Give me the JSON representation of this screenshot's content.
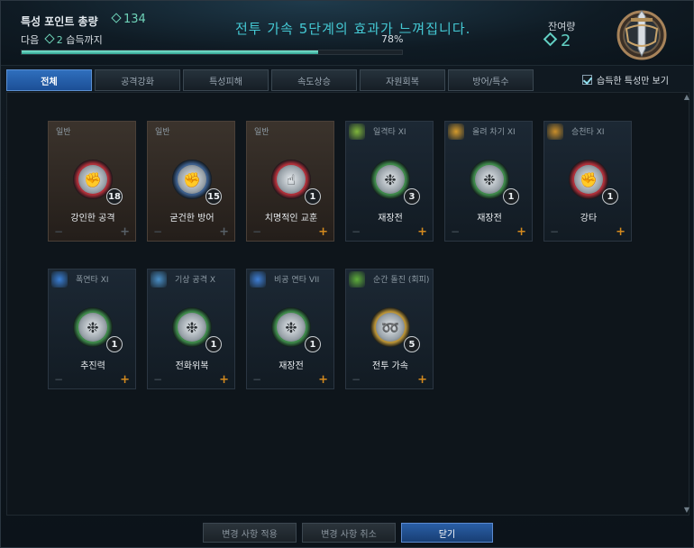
{
  "header": {
    "title": "특성 포인트 총량",
    "total_points": "134",
    "next_prefix": "다음",
    "next_points": "2",
    "next_suffix": "습득까지",
    "message": "전투 가속 5단계의 효과가 느껴집니다.",
    "progress_percent": "78%",
    "progress_value": 0.78,
    "remaining_label": "잔여량",
    "remaining_value": "2"
  },
  "tabs": [
    "전체",
    "공격강화",
    "특성피해",
    "속도상승",
    "자원회복",
    "방어/특수"
  ],
  "show_owned_label": "습득한 특성만 보기",
  "cards": [
    {
      "category": "일반",
      "name": "강인한 공격",
      "count": "18",
      "style": "basic",
      "ring": "#b0303a",
      "icon": "fist-bandage-icon",
      "plus_active": false
    },
    {
      "category": "일반",
      "name": "굳건한 방어",
      "count": "15",
      "style": "basic",
      "ring": "#3d5f8c",
      "icon": "fist-guard-icon",
      "plus_active": false
    },
    {
      "category": "일반",
      "name": "치명적인 교훈",
      "count": "1",
      "style": "basic",
      "ring": "#b0303a",
      "icon": "pointing-hand-icon",
      "plus_active": true
    },
    {
      "category": "일격타 XI",
      "name": "재장전",
      "count": "3",
      "style": "skill",
      "ring": "#3f8a4b",
      "icon": "reload-web-icon",
      "plus_active": true
    },
    {
      "category": "올려 차기 XI",
      "name": "재장전",
      "count": "1",
      "style": "skill",
      "ring": "#3f8a4b",
      "icon": "reload-web-icon",
      "plus_active": true
    },
    {
      "category": "승천타 XI",
      "name": "강타",
      "count": "1",
      "style": "skill",
      "ring": "#b0303a",
      "icon": "fist-icon",
      "plus_active": true
    },
    {
      "category": "폭연타 XI",
      "name": "추진력",
      "count": "1",
      "style": "skill",
      "ring": "#3f8a4b",
      "icon": "reload-web-icon",
      "plus_active": true
    },
    {
      "category": "기상 공격 X",
      "name": "전화위복",
      "count": "1",
      "style": "skill",
      "ring": "#3f8a4b",
      "icon": "reload-web-icon",
      "plus_active": true
    },
    {
      "category": "비공 연타 VII",
      "name": "재장전",
      "count": "1",
      "style": "skill",
      "ring": "#3f8a4b",
      "icon": "reload-web-icon",
      "plus_active": true
    },
    {
      "category": "순간 돌진 (회피)",
      "name": "전투 가속",
      "count": "5",
      "style": "skill",
      "ring": "#b99338",
      "icon": "running-foot-icon",
      "plus_active": true
    }
  ],
  "buttons": {
    "apply": "변경 사항 적용",
    "cancel": "변경 사항 취소",
    "close": "닫기"
  },
  "colors": {
    "accent_teal": "#44c8d3",
    "plus_orange": "#d48a1e",
    "tab_active": "#2f6fbd"
  }
}
